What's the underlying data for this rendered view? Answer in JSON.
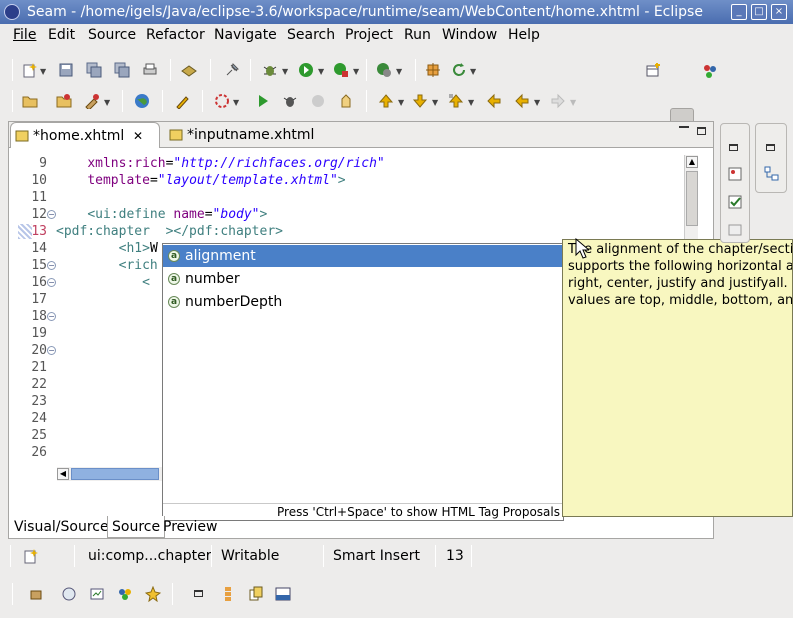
{
  "window": {
    "title": "Seam - /home/igels/Java/eclipse-3.6/workspace/runtime/seam/WebContent/home.xhtml - Eclipse",
    "buttons": {
      "minimize": "_",
      "maximize": "□",
      "close": "×"
    }
  },
  "menu": [
    "File",
    "Edit",
    "Source",
    "Refactor",
    "Navigate",
    "Search",
    "Project",
    "Run",
    "Window",
    "Help"
  ],
  "toolbar": {
    "row1_icons": [
      "new-icon",
      "save-icon",
      "save-as-icon",
      "save-all-icon",
      "print-icon",
      "open-task-icon",
      "pin-icon",
      "debug-icon",
      "run-icon",
      "run-external-icon",
      "coverage-icon",
      "new-seam-icon",
      "refresh-icon"
    ],
    "row2_icons": [
      "open-folder-icon",
      "open-type-icon",
      "external-tools-icon",
      "globe-icon",
      "mark-icon",
      "refresh-server-icon",
      "start-server-icon",
      "debug-server-icon",
      "stop-server-icon",
      "publish-icon",
      "next-annotation-icon",
      "previous-annotation-icon",
      "last-edit-icon",
      "back-icon",
      "forward-icon"
    ],
    "perspectives": [
      "open-perspective-icon",
      "web-perspective-icon",
      "seam-perspective-icon"
    ]
  },
  "editor": {
    "tabs": [
      {
        "label": "*home.xhtml",
        "close": "✕"
      },
      {
        "label": "*inputname.xhtml"
      }
    ],
    "lines": [
      {
        "n": "9",
        "html": "    <span class=\"at\">xmlns:rich</span>=<span class=\"st\">\"http://richfaces.org/rich\"</span>"
      },
      {
        "n": "10",
        "html": "    <span class=\"at\">template</span>=<span class=\"st\">\"layout/template.xhtml\"</span><span class=\"ta\">&gt;</span>"
      },
      {
        "n": "11",
        "html": ""
      },
      {
        "n": "12",
        "fold": "−",
        "html": "    <span class=\"ta\">&lt;ui:define </span><span class=\"at\">name</span>=<span class=\"st\">\"body\"</span><span class=\"ta\">&gt;</span>"
      },
      {
        "n": "13",
        "html": "<span class=\"ta\">&lt;pdf:chapter  &gt;&lt;/pdf:chapter&gt;</span>"
      },
      {
        "n": "14",
        "html": "        <span class=\"ta\">&lt;h1&gt;</span>W"
      },
      {
        "n": "15",
        "fold": "−",
        "html": "        <span class=\"ta\">&lt;rich</span>"
      },
      {
        "n": "16",
        "fold": "−",
        "html": "           <span class=\"ta\">&lt;</span>"
      },
      {
        "n": "17",
        "html": ""
      },
      {
        "n": "18",
        "fold": "−",
        "html": ""
      },
      {
        "n": "19",
        "html": ""
      },
      {
        "n": "20",
        "fold": "−",
        "html": ""
      },
      {
        "n": "21",
        "html": ""
      },
      {
        "n": "22",
        "html": ""
      },
      {
        "n": "23",
        "html": ""
      },
      {
        "n": "24",
        "html": ""
      },
      {
        "n": "25",
        "html": ""
      },
      {
        "n": "26",
        "html": ""
      }
    ],
    "bottom_tabs": [
      "Visual/Source",
      "Source",
      "Preview"
    ]
  },
  "completion": {
    "items": [
      "alignment",
      "number",
      "numberDepth"
    ],
    "item_icon": "a",
    "selected_index": 0,
    "footer": "Press 'Ctrl+Space' to show HTML Tag Proposals",
    "doc_lines": [
      "The alignment of the chapter/section",
      "supports the following horizontal a",
      "right, center, justify and justifyall.",
      "values are top, middle, bottom, an"
    ]
  },
  "status": {
    "path": "ui:comp...chapter",
    "mode": "Writable",
    "insert": "Smart Insert",
    "line": "13"
  }
}
